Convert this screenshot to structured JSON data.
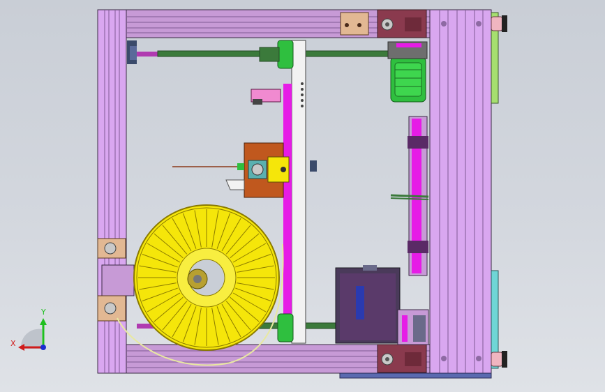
{
  "viewport": {
    "background_top": "#c9ced6",
    "background_bottom": "#dfe2e7"
  },
  "colors": {
    "frame_profile": "#d9a7f0",
    "frame_dark": "#b87fd6",
    "beam": "#c79ad6",
    "bracket": "#8a3a4e",
    "motor": "#2fbf3f",
    "rod": "#3b7a3b",
    "spool": "#f5e60a",
    "spool_outline": "#8a7a00",
    "carriage": "#c0581e",
    "magenta_part": "#e61ce6",
    "control_box": "#4a3a5a",
    "rail": "#f2f2f2"
  },
  "triad": {
    "y_label": "Y",
    "x_label": "X",
    "y_color": "#1fbf1f",
    "x_color": "#d01a1a",
    "z_color": "#1a2ed0"
  },
  "icons": [
    "coordinate-triad-icon"
  ]
}
